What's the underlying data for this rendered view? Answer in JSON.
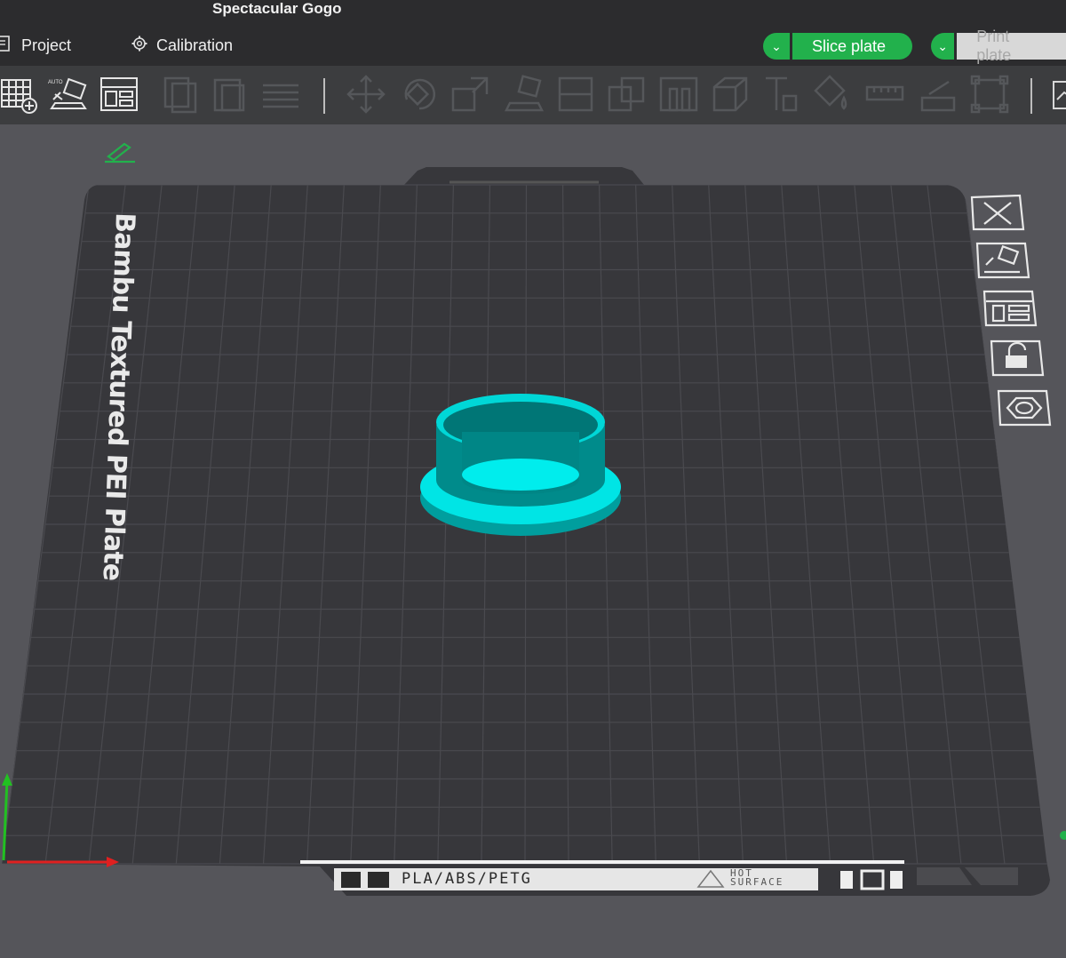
{
  "window": {
    "title": "Spectacular Gogo"
  },
  "menu": {
    "project_label": "Project",
    "calibration_label": "Calibration"
  },
  "actions": {
    "slice_label": "Slice plate",
    "print_label": "Print plate"
  },
  "colors": {
    "accent_green": "#22b14c",
    "model_cyan": "#00e5e5",
    "plate": "#37373b",
    "background": "#55555a"
  },
  "plate": {
    "brand_label": "Bambu Textured PEI Plate",
    "materials": "PLA/ABS/PETG",
    "warning_line1": "HOT",
    "warning_line2": "SURFACE"
  },
  "toolbar_icons": [
    "add-plate-icon",
    "auto-arrange-icon",
    "orient-icon",
    "copy-icon",
    "paste-icon",
    "layers-icon",
    "move-icon",
    "rotate-icon",
    "scale-icon",
    "lay-on-face-icon",
    "cut-icon",
    "boolean-icon",
    "support-paint-icon",
    "seam-icon",
    "text-icon",
    "color-paint-icon",
    "measure-icon",
    "assembly-icon",
    "split-icon"
  ],
  "side_tools": [
    "close-plate-icon",
    "auto-orient-icon",
    "arrange-icon",
    "lock-icon",
    "plate-settings-icon"
  ]
}
